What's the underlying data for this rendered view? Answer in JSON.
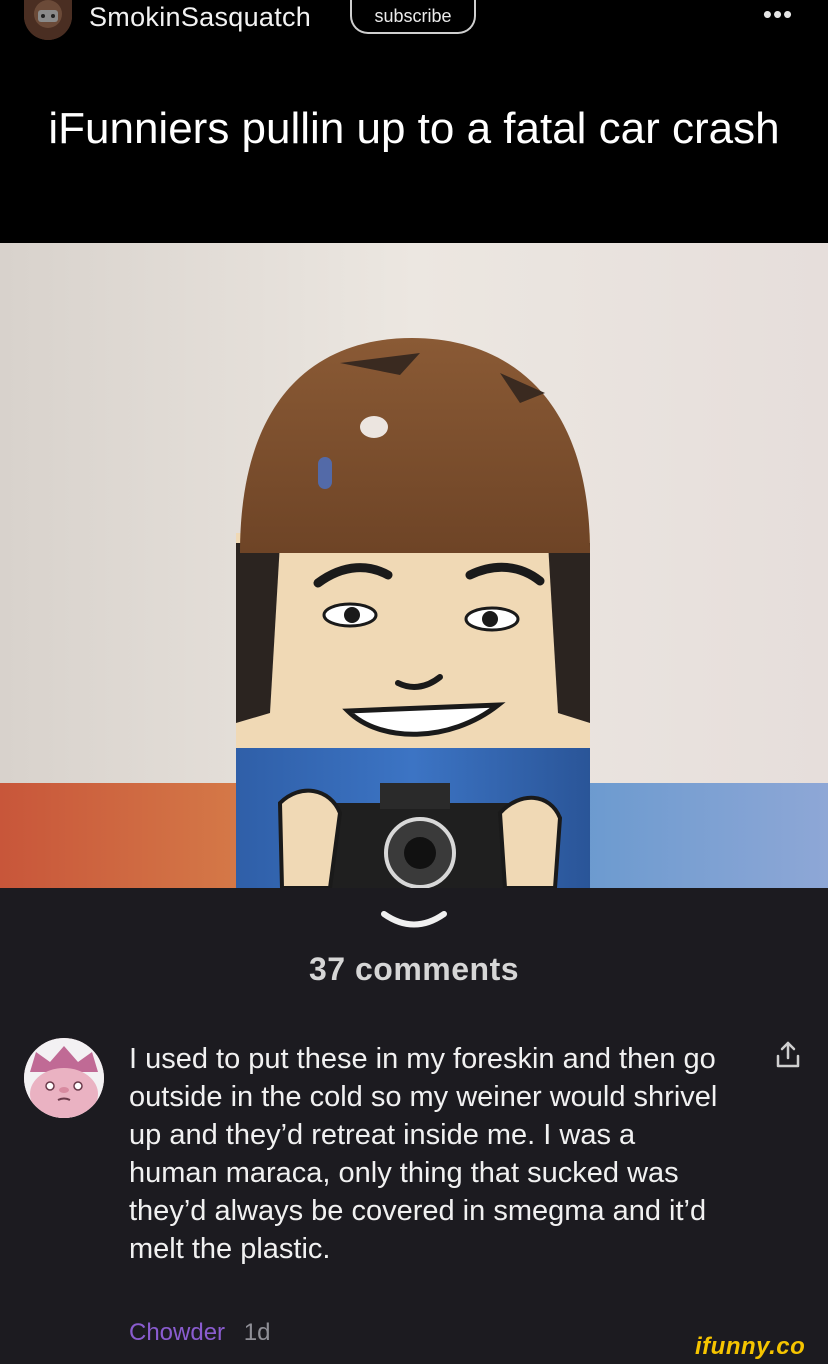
{
  "header": {
    "username": "SmokinSasquatch",
    "subscribe_label": "subscribe",
    "more_label": "•••"
  },
  "post": {
    "caption": "iFunniers pullin up to a fatal car crash"
  },
  "comments": {
    "count_label": "37 comments",
    "items": [
      {
        "text": "I used to put these in my foreskin and then go outside in the cold so my weiner would shrivel up and they’d retreat inside me. I was a human maraca, only thing that sucked was they’d always be covered in smegma and it’d melt the plastic.",
        "author": "Chowder",
        "time": "1d"
      }
    ]
  },
  "watermark": {
    "text": "ifunny.co"
  },
  "colors": {
    "background": "#1c1b20",
    "header_bg": "#000000",
    "author": "#8a5ccf",
    "watermark": "#f5c400"
  },
  "icons": {
    "more": "ellipsis-icon",
    "collapse": "chevron-down-icon",
    "share": "share-icon"
  }
}
